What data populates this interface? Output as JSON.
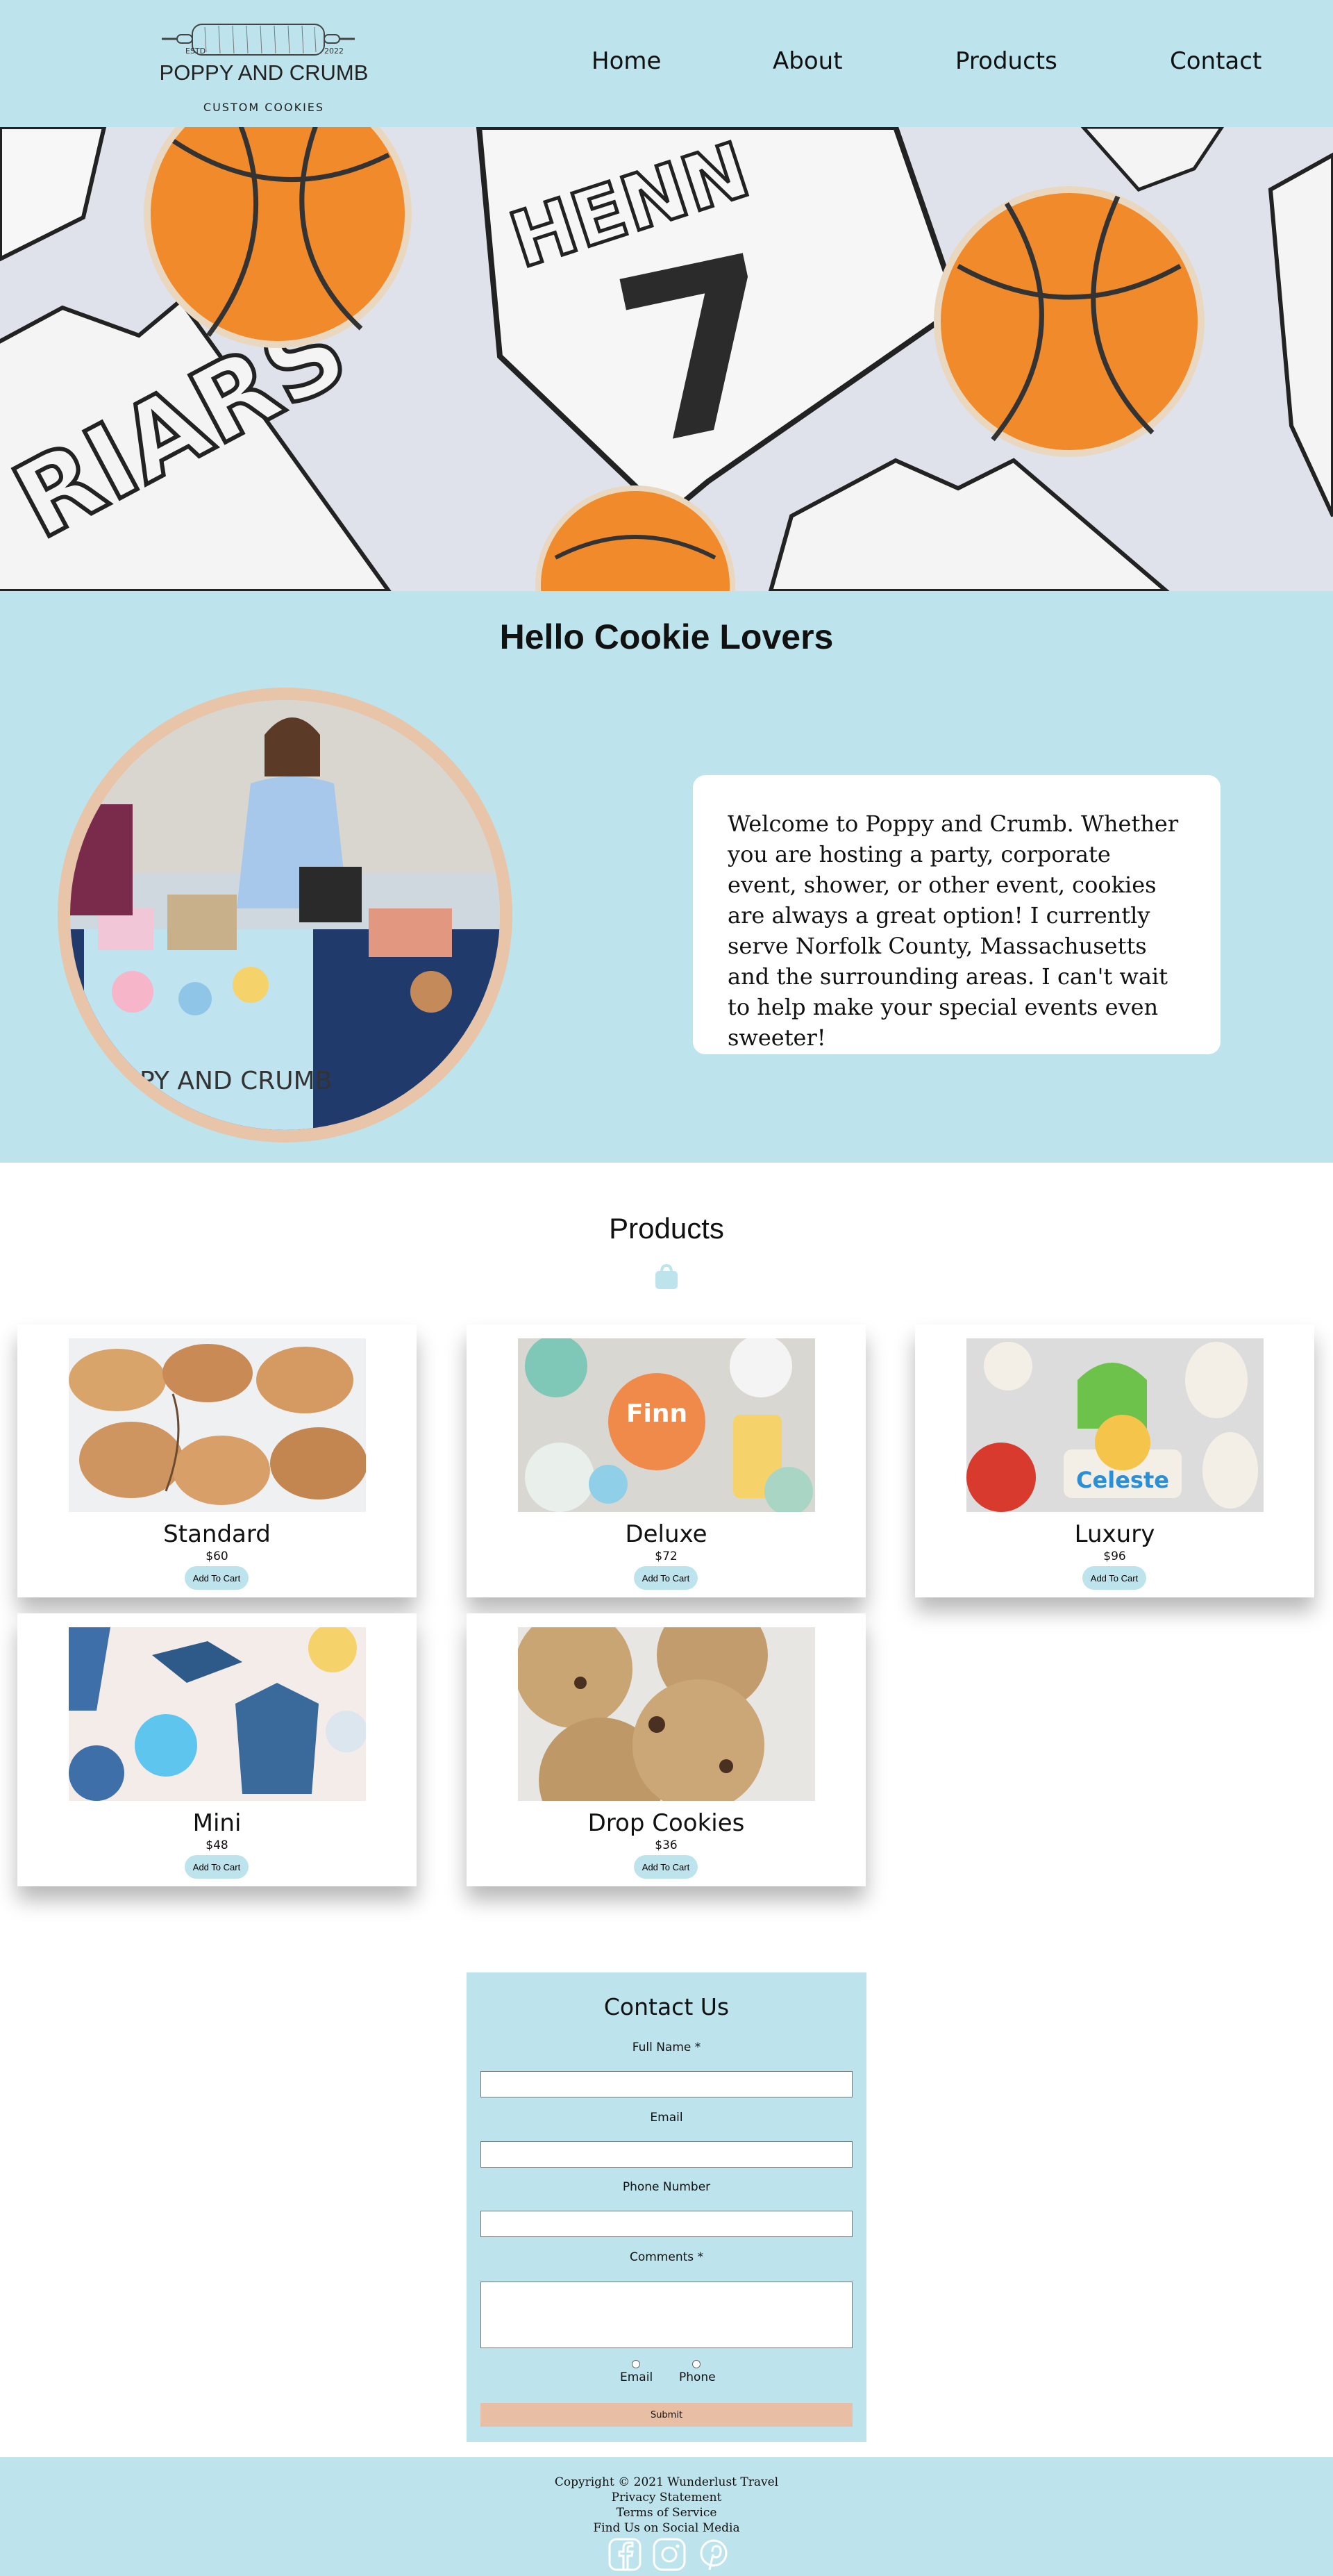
{
  "brand": {
    "estd": "ESTD",
    "year": "2022",
    "name": "POPPY AND CRUMB",
    "tagline": "CUSTOM COOKIES"
  },
  "nav": {
    "items": [
      {
        "label": "Home"
      },
      {
        "label": "About"
      },
      {
        "label": "Products"
      },
      {
        "label": "Contact"
      }
    ]
  },
  "hero": {
    "jersey_name_text": "HENN",
    "jersey_number_text": "7",
    "jersey2_text": "RIARS",
    "colors": {
      "basketball": "#f08a2a",
      "icing": "#f4f4f4",
      "background": "#dfe1ea"
    }
  },
  "about": {
    "title": "Hello Cookie Lovers",
    "text": "Welcome to Poppy and Crumb. Whether you are hosting a party, corporate event, shower, or other event, cookies are always a great option! I currently serve Norfolk County, Massachusetts and the surrounding areas. I can't wait to help make your special events even sweeter!",
    "photo_banner_text": "PY AND CRUMB"
  },
  "products": {
    "title": "Products",
    "icon": "shopping-bag-icon",
    "items": [
      {
        "name": "Standard",
        "price": "$60",
        "button": "Add To Cart"
      },
      {
        "name": "Deluxe",
        "price": "$72",
        "button": "Add To Cart",
        "cookie_text": "Finn"
      },
      {
        "name": "Luxury",
        "price": "$96",
        "button": "Add To Cart",
        "cookie_text": "Celeste"
      },
      {
        "name": "Mini",
        "price": "$48",
        "button": "Add To Cart"
      },
      {
        "name": "Drop Cookies",
        "price": "$36",
        "button": "Add To Cart"
      }
    ]
  },
  "contact": {
    "title": "Contact Us",
    "fields": [
      {
        "label": "Full Name *",
        "value": ""
      },
      {
        "label": "Email",
        "value": ""
      },
      {
        "label": "Phone Number",
        "value": ""
      },
      {
        "label": "Comments *",
        "value": ""
      }
    ],
    "contact_methods": [
      {
        "label": "Email",
        "selected": false
      },
      {
        "label": "Phone",
        "selected": false
      }
    ],
    "submit": "Submit"
  },
  "footer": {
    "copyright": "Copyright © 2021 Wunderlust Travel",
    "privacy": "Privacy Statement",
    "terms": "Terms of Service",
    "social": "Find Us on Social Media",
    "icons": [
      "facebook-icon",
      "instagram-icon",
      "pinterest-icon"
    ]
  },
  "colors": {
    "accent": "#bde4ec",
    "peach": "#e8bfa5",
    "text": "#111111"
  }
}
